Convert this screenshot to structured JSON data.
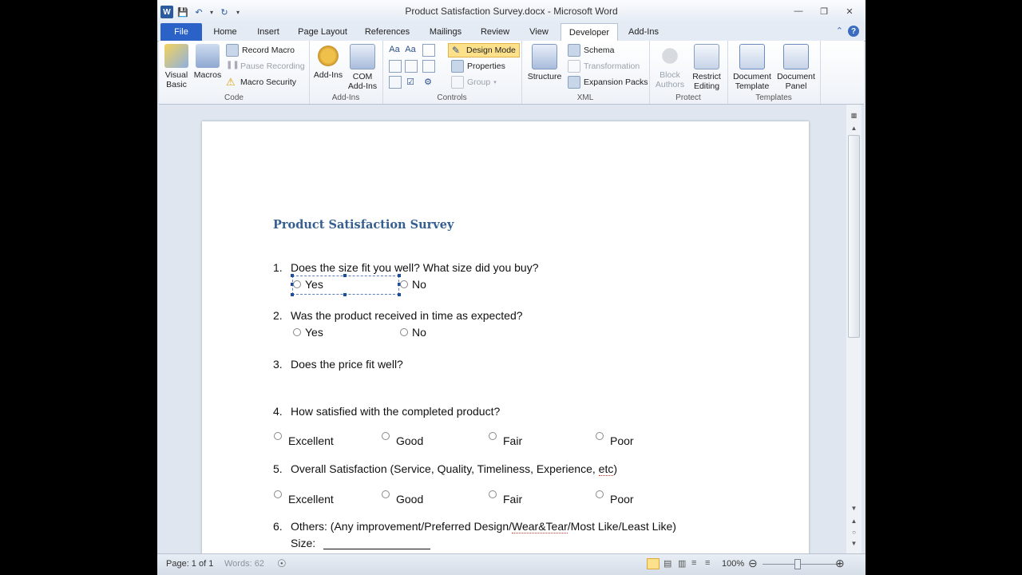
{
  "window": {
    "title": "Product Satisfaction Survey.docx - Microsoft Word"
  },
  "tabs": [
    "File",
    "Home",
    "Insert",
    "Page Layout",
    "References",
    "Mailings",
    "Review",
    "View",
    "Developer",
    "Add-Ins"
  ],
  "ribbon": {
    "code": {
      "label": "Code",
      "visual_basic": [
        "Visual",
        "Basic"
      ],
      "macros": "Macros",
      "record_macro": "Record Macro",
      "pause_recording": "Pause Recording",
      "macro_security": "Macro Security"
    },
    "addins": {
      "label": "Add-Ins",
      "addins": "Add-Ins",
      "com": [
        "COM",
        "Add-Ins"
      ]
    },
    "controls": {
      "label": "Controls",
      "design_mode": "Design Mode",
      "properties": "Properties",
      "group": "Group"
    },
    "xml": {
      "label": "XML",
      "structure": "Structure",
      "schema": "Schema",
      "transformation": "Transformation",
      "expansion_packs": "Expansion Packs"
    },
    "protect": {
      "label": "Protect",
      "block_authors": [
        "Block",
        "Authors"
      ],
      "restrict_editing": [
        "Restrict",
        "Editing"
      ]
    },
    "templates": {
      "label": "Templates",
      "document_template": [
        "Document",
        "Template"
      ],
      "document_panel": [
        "Document",
        "Panel"
      ]
    }
  },
  "document": {
    "title": "Product Satisfaction Survey",
    "questions": [
      {
        "num": "1.",
        "text": "Does the size fit you well? What size did you buy?",
        "options": [
          "Yes",
          "No"
        ]
      },
      {
        "num": "2.",
        "text": "Was the product received in time as expected?",
        "options": [
          "Yes",
          "No"
        ]
      },
      {
        "num": "3.",
        "text": "Does the price fit well?"
      },
      {
        "num": "4.",
        "text": "How satisfied with the completed product?",
        "options": [
          "Excellent",
          "Good",
          "Fair",
          "Poor"
        ]
      },
      {
        "num": "5.",
        "text_pre": "Overall Satisfaction (Service, Quality, Timeliness, Experience, ",
        "text_squig": "etc",
        "text_post": ")",
        "options": [
          "Excellent",
          "Good",
          "Fair",
          "Poor"
        ]
      },
      {
        "num": "6.",
        "text_pre": "Others: (Any improvement/Preferred Design/",
        "text_squig": "Wear&Tear",
        "text_post": "/Most Like/Least Like)",
        "size_label": "Size:"
      }
    ]
  },
  "status": {
    "page": "Page: 1 of 1",
    "words": "Words: 62",
    "zoom": "100%"
  }
}
